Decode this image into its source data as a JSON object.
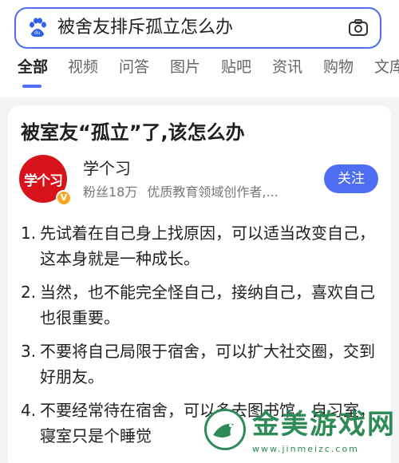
{
  "search": {
    "query": "被舍友排斥孤立怎么办",
    "logo_icon": "baidu-paw-icon",
    "camera_icon": "camera-icon",
    "accent": "#4e6ef2"
  },
  "tabs": [
    {
      "label": "全部",
      "active": true
    },
    {
      "label": "视频"
    },
    {
      "label": "问答"
    },
    {
      "label": "图片"
    },
    {
      "label": "贴吧"
    },
    {
      "label": "资讯"
    },
    {
      "label": "购物"
    },
    {
      "label": "文库"
    }
  ],
  "card": {
    "title": "被室友“孤立”了,该怎么办",
    "author": {
      "avatar_text": "学个习",
      "name": "学个习",
      "badge": "V",
      "fans": "粉丝18万",
      "desc": "优质教育领域创作者,...",
      "follow_label": "关注"
    },
    "items": [
      {
        "num": "1.",
        "text": "先试着在自己身上找原因，可以适当改变自己，这本身就是一种成长。"
      },
      {
        "num": "2.",
        "text": "当然，也不能完全怪自己，接纳自己，喜欢自己也很重要。"
      },
      {
        "num": "3.",
        "text": "不要将自己局限于宿舍，可以扩大社交圈，交到好朋友。"
      },
      {
        "num": "4.",
        "text": "不要经常待在宿舍，可以多去图书馆、自习室，寝室只是个睡觉"
      }
    ]
  },
  "watermark": {
    "brand": "金美游戏网",
    "url": "www.jinmeizc.com",
    "color": "#2e8b57"
  }
}
